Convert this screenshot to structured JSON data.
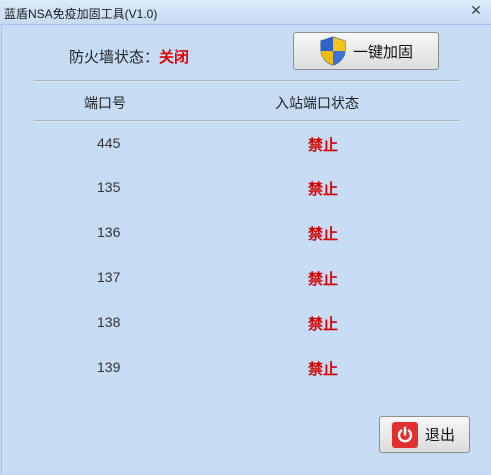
{
  "window": {
    "title": "蓝盾NSA免疫加固工具(V1.0)",
    "close_glyph": "✕"
  },
  "firewall": {
    "label": "防火墙状态：",
    "value": "关闭",
    "value_color": "#e00000"
  },
  "toolbar": {
    "harden_label": "一键加固",
    "exit_label": "退出"
  },
  "table": {
    "headers": {
      "port": "端口号",
      "status": "入站端口状态"
    },
    "rows": [
      {
        "port": "445",
        "status": "禁止"
      },
      {
        "port": "135",
        "status": "禁止"
      },
      {
        "port": "136",
        "status": "禁止"
      },
      {
        "port": "137",
        "status": "禁止"
      },
      {
        "port": "138",
        "status": "禁止"
      },
      {
        "port": "139",
        "status": "禁止"
      }
    ]
  },
  "icons": {
    "harden": "shield-icon",
    "exit": "power-icon",
    "close": "close-icon"
  },
  "colors": {
    "background": "#c6dcf5",
    "status_red": "#d40000"
  }
}
